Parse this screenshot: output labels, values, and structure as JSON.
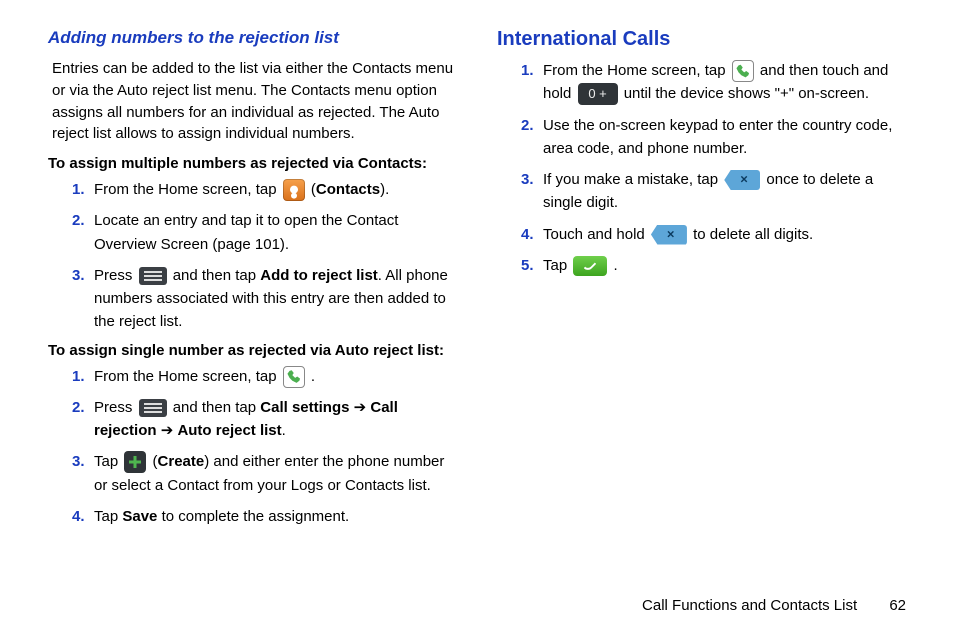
{
  "left": {
    "heading": "Adding numbers to the rejection list",
    "intro": "Entries can be added to the list via either the Contacts menu or via the Auto reject list menu. The Contacts menu option assigns all numbers for an individual as rejected. The Auto reject list allows to assign individual numbers.",
    "sectionA_title": "To assign multiple numbers as rejected via Contacts:",
    "a1_pre": "From the Home screen, tap ",
    "a1_post_open": " (",
    "a1_contacts": "Contacts",
    "a1_post_close": ").",
    "a2": "Locate an entry and tap it to open the Contact Overview Screen (page 101).",
    "a3_pre": "Press ",
    "a3_mid": " and then tap ",
    "a3_bold": "Add to reject list",
    "a3_post": ". All phone numbers associated with this entry are then added to the reject list.",
    "sectionB_title": "To assign single number as rejected via Auto reject list:",
    "b1_pre": "From the Home screen, tap ",
    "b1_post": " .",
    "b2_pre": "Press ",
    "b2_mid": " and then tap ",
    "b2_bold1": "Call settings",
    "b2_arrow": " ➔ ",
    "b2_bold2": "Call rejection",
    "b2_bold3": "Auto reject list",
    "b2_end": ".",
    "b3_pre": "Tap ",
    "b3_open": " (",
    "b3_create": "Create",
    "b3_close": ") and either enter the phone number or select a Contact from your Logs or Contacts list.",
    "b4_pre": "Tap ",
    "b4_save": "Save",
    "b4_post": " to complete the assignment."
  },
  "right": {
    "heading": "International Calls",
    "r1_pre": "From the Home screen, tap ",
    "r1_mid": " and then touch and hold ",
    "r1_zero": "0  +",
    "r1_post": " until the device shows  \"+\" on-screen.",
    "r2": "Use the on-screen keypad to enter the country code, area code, and phone number.",
    "r3_pre": "If you make a mistake, tap ",
    "r3_post": " once to delete a single digit.",
    "r4_pre": "Touch and hold ",
    "r4_post": " to delete all digits.",
    "r5_pre": "Tap ",
    "r5_post": " ."
  },
  "nums": {
    "1": "1.",
    "2": "2.",
    "3": "3.",
    "4": "4.",
    "5": "5."
  },
  "footer": {
    "section": "Call Functions and Contacts List",
    "page": "62"
  }
}
